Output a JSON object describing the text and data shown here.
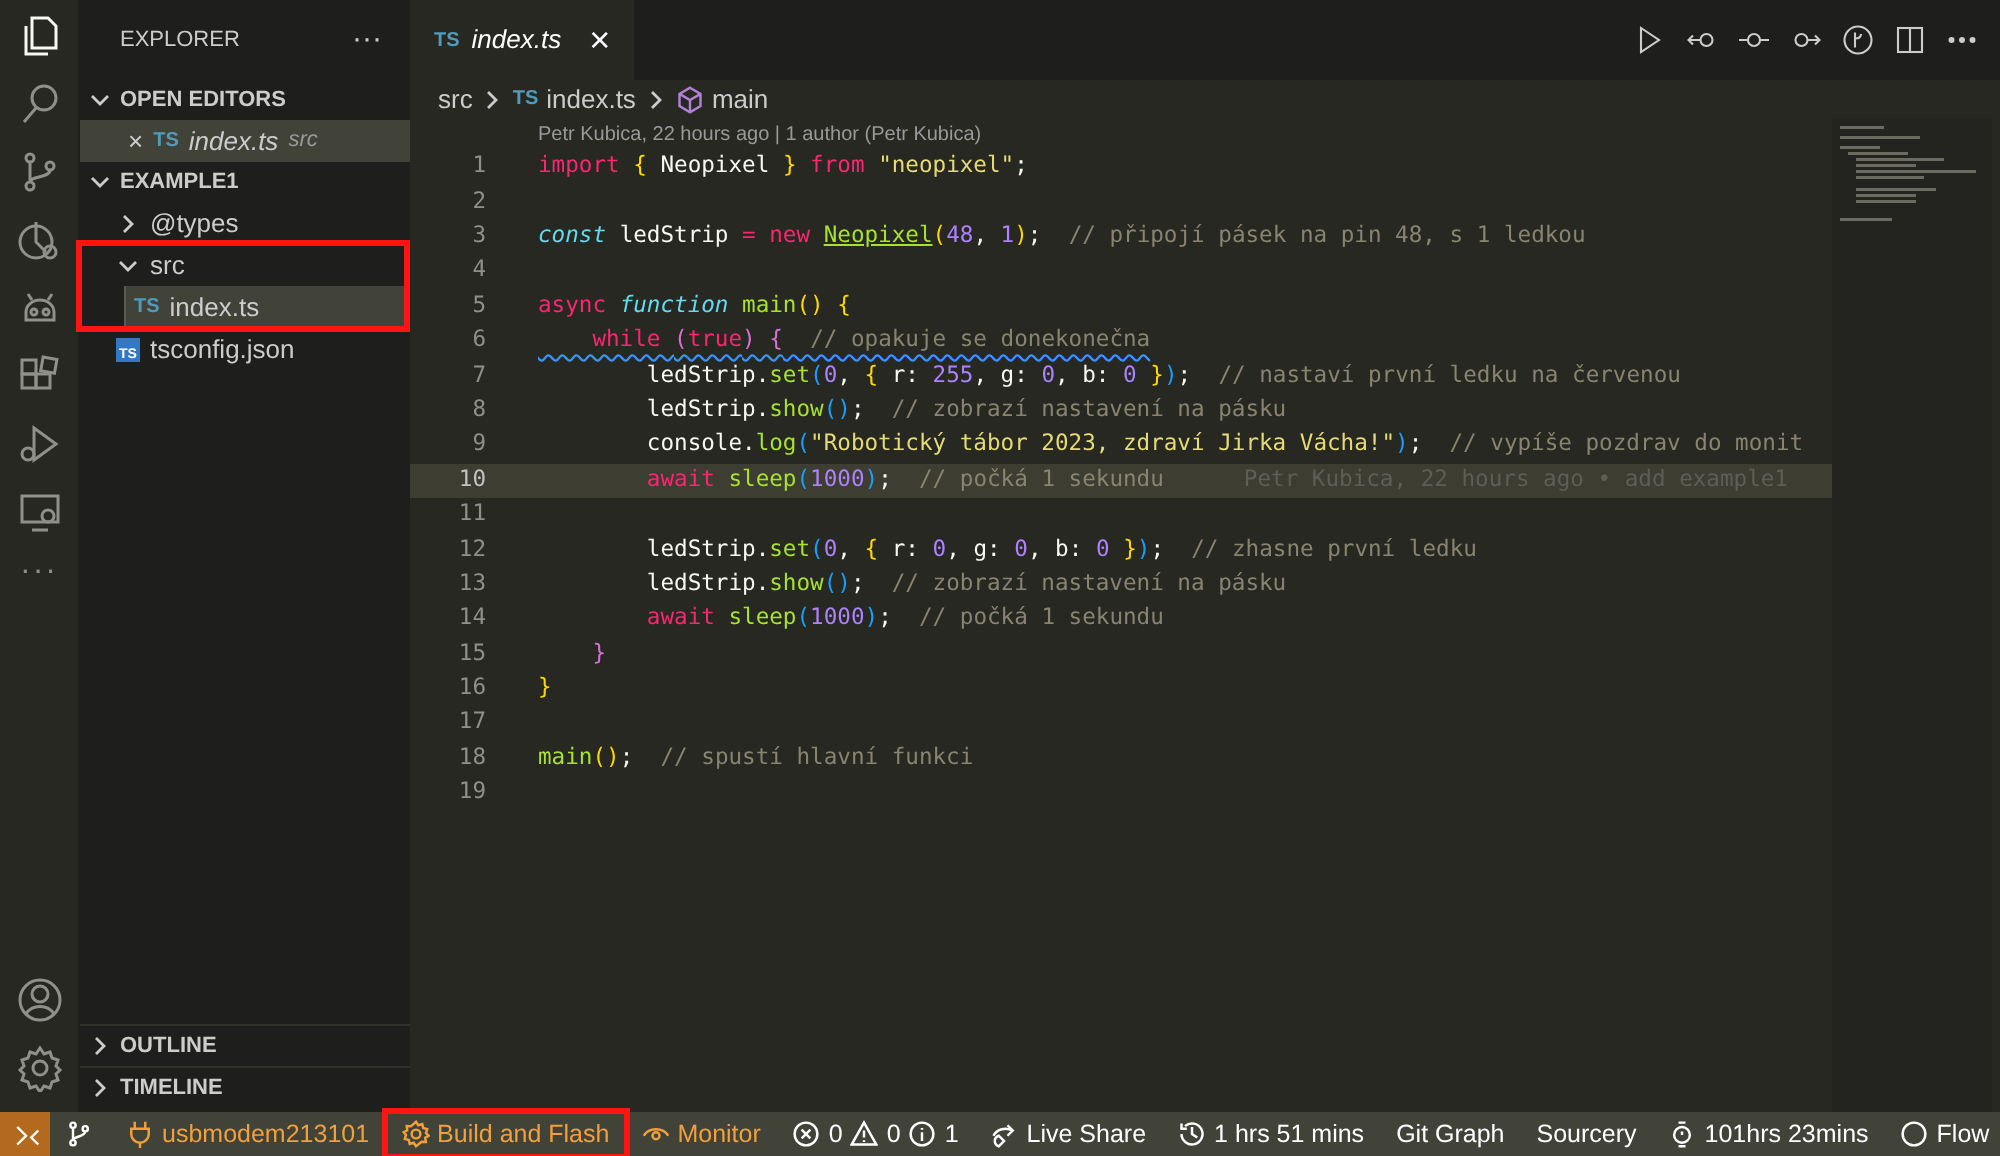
{
  "activity_bar": {
    "top_items": [
      {
        "selected": true
      },
      {
        "selected": false
      },
      {
        "selected": false
      },
      {
        "selected": false
      },
      {
        "selected": false
      },
      {
        "selected": false
      },
      {
        "selected": false
      },
      {
        "selected": false
      }
    ],
    "more": "···"
  },
  "sidebar": {
    "title": "EXPLORER",
    "more": "···",
    "open_editors": {
      "label": "OPEN EDITORS",
      "expanded": true,
      "items": [
        {
          "close": "×",
          "badge": "TS",
          "name": "index.ts",
          "folder": "src",
          "selected": true
        }
      ]
    },
    "workspace": {
      "label": "EXAMPLE1",
      "expanded": true,
      "children": [
        {
          "name": "@types",
          "kind": "folder",
          "expanded": false,
          "outlined": false,
          "selected": false
        },
        {
          "name": "src",
          "kind": "folder",
          "expanded": true,
          "outlined": true,
          "selected": false,
          "children": [
            {
              "name": "index.ts",
              "kind": "file",
              "badge": "TS",
              "selected": true
            }
          ]
        },
        {
          "name": "tsconfig.json",
          "kind": "file",
          "badge": "TS",
          "boxed": true,
          "selected": false
        }
      ]
    },
    "panels": [
      {
        "label": "OUTLINE",
        "expanded": false
      },
      {
        "label": "TIMELINE",
        "expanded": false
      }
    ]
  },
  "editor": {
    "tab": {
      "badge": "TS",
      "label": "index.ts",
      "preview": true,
      "close": "×"
    },
    "breadcrumbs": [
      {
        "kind": "folder",
        "text": "src"
      },
      {
        "kind": "file",
        "badge": "TS",
        "text": "index.ts"
      },
      {
        "kind": "symbol",
        "text": "main"
      }
    ],
    "codelens": "Petr Kubica, 22 hours ago | 1 author (Petr Kubica)",
    "lines": [
      {
        "number": "1",
        "current": false,
        "squiggle": false,
        "tokens": [
          {
            "kind": "keyword",
            "text": "import "
          },
          {
            "kind": "b1",
            "text": "{"
          },
          {
            "kind": "plain",
            "text": " Neopixel "
          },
          {
            "kind": "b1",
            "text": "}"
          },
          {
            "kind": "keyword",
            "text": " from "
          },
          {
            "kind": "string",
            "text": "\"neopixel\""
          },
          {
            "kind": "plain",
            "text": ";"
          }
        ]
      },
      {
        "number": "2",
        "current": false
      },
      {
        "number": "3",
        "current": false,
        "squiggle": false,
        "tokens": [
          {
            "kind": "storage",
            "text": "const"
          },
          {
            "kind": "plain",
            "text": " ledStrip "
          },
          {
            "kind": "keyword",
            "text": "= new "
          },
          {
            "kind": "class",
            "text": "Neopixel"
          },
          {
            "kind": "b1",
            "text": "("
          },
          {
            "kind": "number",
            "text": "48"
          },
          {
            "kind": "plain",
            "text": ", "
          },
          {
            "kind": "number",
            "text": "1"
          },
          {
            "kind": "b1",
            "text": ")"
          },
          {
            "kind": "plain",
            "text": ";  "
          },
          {
            "kind": "comment",
            "text": "// připojí pásek na pin 48, s 1 ledkou"
          }
        ]
      },
      {
        "number": "4",
        "current": false
      },
      {
        "number": "5",
        "current": false,
        "squiggle": false,
        "tokens": [
          {
            "kind": "keyword",
            "text": "async "
          },
          {
            "kind": "storage",
            "text": "function "
          },
          {
            "kind": "function",
            "text": "main"
          },
          {
            "kind": "b1",
            "text": "()"
          },
          {
            "kind": "b1",
            "text": " {"
          }
        ]
      },
      {
        "number": "6",
        "current": false,
        "squiggle": true,
        "tokens": [
          {
            "kind": "keyword",
            "text": "    while "
          },
          {
            "kind": "b2",
            "text": "("
          },
          {
            "kind": "keyword",
            "text": "true"
          },
          {
            "kind": "b2",
            "text": ")"
          },
          {
            "kind": "b2",
            "text": " {"
          },
          {
            "kind": "comment",
            "text": "  // opakuje se donekonečna"
          }
        ]
      },
      {
        "number": "7",
        "current": false,
        "squiggle": false,
        "tokens": [
          {
            "kind": "plain",
            "text": "        ledStrip."
          },
          {
            "kind": "function",
            "text": "set"
          },
          {
            "kind": "b3",
            "text": "("
          },
          {
            "kind": "number",
            "text": "0"
          },
          {
            "kind": "plain",
            "text": ", "
          },
          {
            "kind": "b1",
            "text": "{"
          },
          {
            "kind": "plain",
            "text": " r: "
          },
          {
            "kind": "number",
            "text": "255"
          },
          {
            "kind": "plain",
            "text": ", g: "
          },
          {
            "kind": "number",
            "text": "0"
          },
          {
            "kind": "plain",
            "text": ", b: "
          },
          {
            "kind": "number",
            "text": "0"
          },
          {
            "kind": "b1",
            "text": " }"
          },
          {
            "kind": "b3",
            "text": ")"
          },
          {
            "kind": "plain",
            "text": ";  "
          },
          {
            "kind": "comment",
            "text": "// nastaví první ledku na červenou"
          }
        ]
      },
      {
        "number": "8",
        "current": false,
        "squiggle": false,
        "tokens": [
          {
            "kind": "plain",
            "text": "        ledStrip."
          },
          {
            "kind": "function",
            "text": "show"
          },
          {
            "kind": "b3",
            "text": "()"
          },
          {
            "kind": "plain",
            "text": ";  "
          },
          {
            "kind": "comment",
            "text": "// zobrazí nastavení na pásku"
          }
        ]
      },
      {
        "number": "9",
        "current": false,
        "squiggle": false,
        "tokens": [
          {
            "kind": "plain",
            "text": "        console."
          },
          {
            "kind": "function",
            "text": "log"
          },
          {
            "kind": "b3",
            "text": "("
          },
          {
            "kind": "string",
            "text": "\"Robotický tábor 2023, zdraví Jirka Vácha!\""
          },
          {
            "kind": "b3",
            "text": ")"
          },
          {
            "kind": "plain",
            "text": ";  "
          },
          {
            "kind": "comment",
            "text": "// vypíše pozdrav do monit"
          }
        ]
      },
      {
        "number": "10",
        "current": true,
        "squiggle": false,
        "blame": "Petr Kubica, 22 hours ago • add example1",
        "tokens": [
          {
            "kind": "keyword",
            "text": "        await "
          },
          {
            "kind": "function",
            "text": "sleep"
          },
          {
            "kind": "b3",
            "text": "("
          },
          {
            "kind": "number",
            "text": "1000"
          },
          {
            "kind": "b3",
            "text": ")"
          },
          {
            "kind": "plain",
            "text": ";  "
          },
          {
            "kind": "comment",
            "text": "// počká 1 sekundu"
          }
        ]
      },
      {
        "number": "11",
        "current": false
      },
      {
        "number": "12",
        "current": false,
        "squiggle": false,
        "tokens": [
          {
            "kind": "plain",
            "text": "        ledStrip."
          },
          {
            "kind": "function",
            "text": "set"
          },
          {
            "kind": "b3",
            "text": "("
          },
          {
            "kind": "number",
            "text": "0"
          },
          {
            "kind": "plain",
            "text": ", "
          },
          {
            "kind": "b1",
            "text": "{"
          },
          {
            "kind": "plain",
            "text": " r: "
          },
          {
            "kind": "number",
            "text": "0"
          },
          {
            "kind": "plain",
            "text": ", g: "
          },
          {
            "kind": "number",
            "text": "0"
          },
          {
            "kind": "plain",
            "text": ", b: "
          },
          {
            "kind": "number",
            "text": "0"
          },
          {
            "kind": "b1",
            "text": " }"
          },
          {
            "kind": "b3",
            "text": ")"
          },
          {
            "kind": "plain",
            "text": ";  "
          },
          {
            "kind": "comment",
            "text": "// zhasne první ledku"
          }
        ]
      },
      {
        "number": "13",
        "current": false,
        "squiggle": false,
        "tokens": [
          {
            "kind": "plain",
            "text": "        ledStrip."
          },
          {
            "kind": "function",
            "text": "show"
          },
          {
            "kind": "b3",
            "text": "()"
          },
          {
            "kind": "plain",
            "text": ";  "
          },
          {
            "kind": "comment",
            "text": "// zobrazí nastavení na pásku"
          }
        ]
      },
      {
        "number": "14",
        "current": false,
        "squiggle": false,
        "tokens": [
          {
            "kind": "keyword",
            "text": "        await "
          },
          {
            "kind": "function",
            "text": "sleep"
          },
          {
            "kind": "b3",
            "text": "("
          },
          {
            "kind": "number",
            "text": "1000"
          },
          {
            "kind": "b3",
            "text": ")"
          },
          {
            "kind": "plain",
            "text": ";  "
          },
          {
            "kind": "comment",
            "text": "// počká 1 sekundu"
          }
        ]
      },
      {
        "number": "15",
        "current": false,
        "squiggle": false,
        "tokens": [
          {
            "kind": "b2",
            "text": "    }"
          }
        ]
      },
      {
        "number": "16",
        "current": false,
        "squiggle": false,
        "tokens": [
          {
            "kind": "b1",
            "text": "}"
          }
        ]
      },
      {
        "number": "17",
        "current": false
      },
      {
        "number": "18",
        "current": false,
        "squiggle": false,
        "tokens": [
          {
            "kind": "function",
            "text": "main"
          },
          {
            "kind": "b1",
            "text": "()"
          },
          {
            "kind": "plain",
            "text": ";  "
          },
          {
            "kind": "comment",
            "text": "// spustí hlavní funkci"
          }
        ]
      },
      {
        "number": "19",
        "current": false
      }
    ]
  },
  "status_bar": {
    "items": [
      {
        "kind": "remote",
        "accent": false,
        "outlined": false
      },
      {
        "kind": "icon",
        "accent": false,
        "outlined": false
      },
      {
        "kind": "item",
        "text": "usbmodem213101",
        "accent": true,
        "outlined": false
      },
      {
        "kind": "item",
        "text": "Build and Flash",
        "accent": true,
        "outlined": true
      },
      {
        "kind": "item",
        "text": "Monitor",
        "accent": true,
        "outlined": false
      },
      {
        "kind": "item",
        "text": "0",
        "accent": false,
        "outlined": false
      },
      {
        "kind": "item",
        "text": "0",
        "accent": false,
        "outlined": false
      },
      {
        "kind": "item",
        "text": "1",
        "accent": false,
        "outlined": false
      },
      {
        "kind": "item",
        "text": "Live Share",
        "accent": false,
        "outlined": false
      },
      {
        "kind": "item",
        "text": "1 hrs 51 mins",
        "accent": false,
        "outlined": false
      },
      {
        "kind": "text",
        "text": "Git Graph",
        "accent": false,
        "outlined": false
      },
      {
        "kind": "text",
        "text": "Sourcery",
        "accent": false,
        "outlined": false
      },
      {
        "kind": "item",
        "text": "101hrs 23mins",
        "accent": false,
        "outlined": false
      },
      {
        "kind": "item",
        "text": "Flow",
        "accent": false,
        "outlined": false,
        "right": true
      }
    ]
  }
}
